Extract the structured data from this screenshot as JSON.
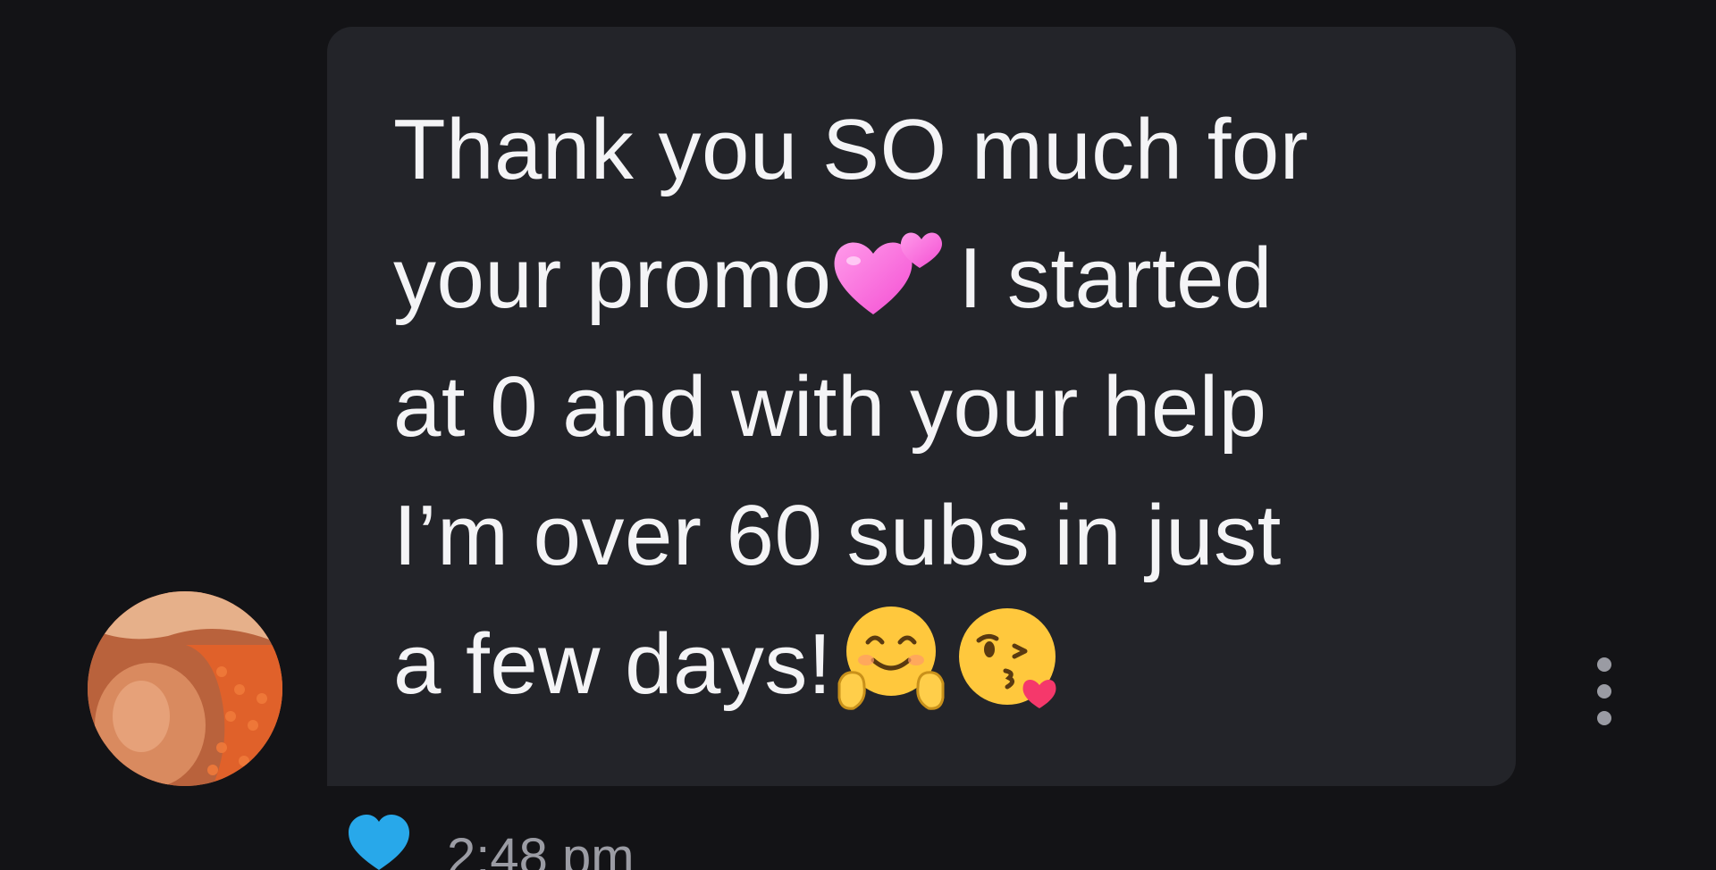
{
  "message": {
    "lines": [
      {
        "text": "Thank you SO much for"
      },
      {
        "before": "your promo",
        "emoji": "two-hearts",
        "after": "I started"
      },
      {
        "text": "at 0 and with your help"
      },
      {
        "text": "I’m over 60 subs in just"
      },
      {
        "before": "a few days!",
        "emojis": [
          "hugging-face",
          "face-blowing-a-kiss"
        ]
      }
    ]
  },
  "footer": {
    "like_icon": "heart-icon",
    "like_color": "#28a8ea",
    "timestamp": "2:48 pm"
  },
  "colors": {
    "background": "#131316",
    "bubble": "#232429",
    "text": "#f4f4f6",
    "muted": "#9b9ca4"
  },
  "actions": {
    "more_icon": "more-vertical-icon"
  }
}
